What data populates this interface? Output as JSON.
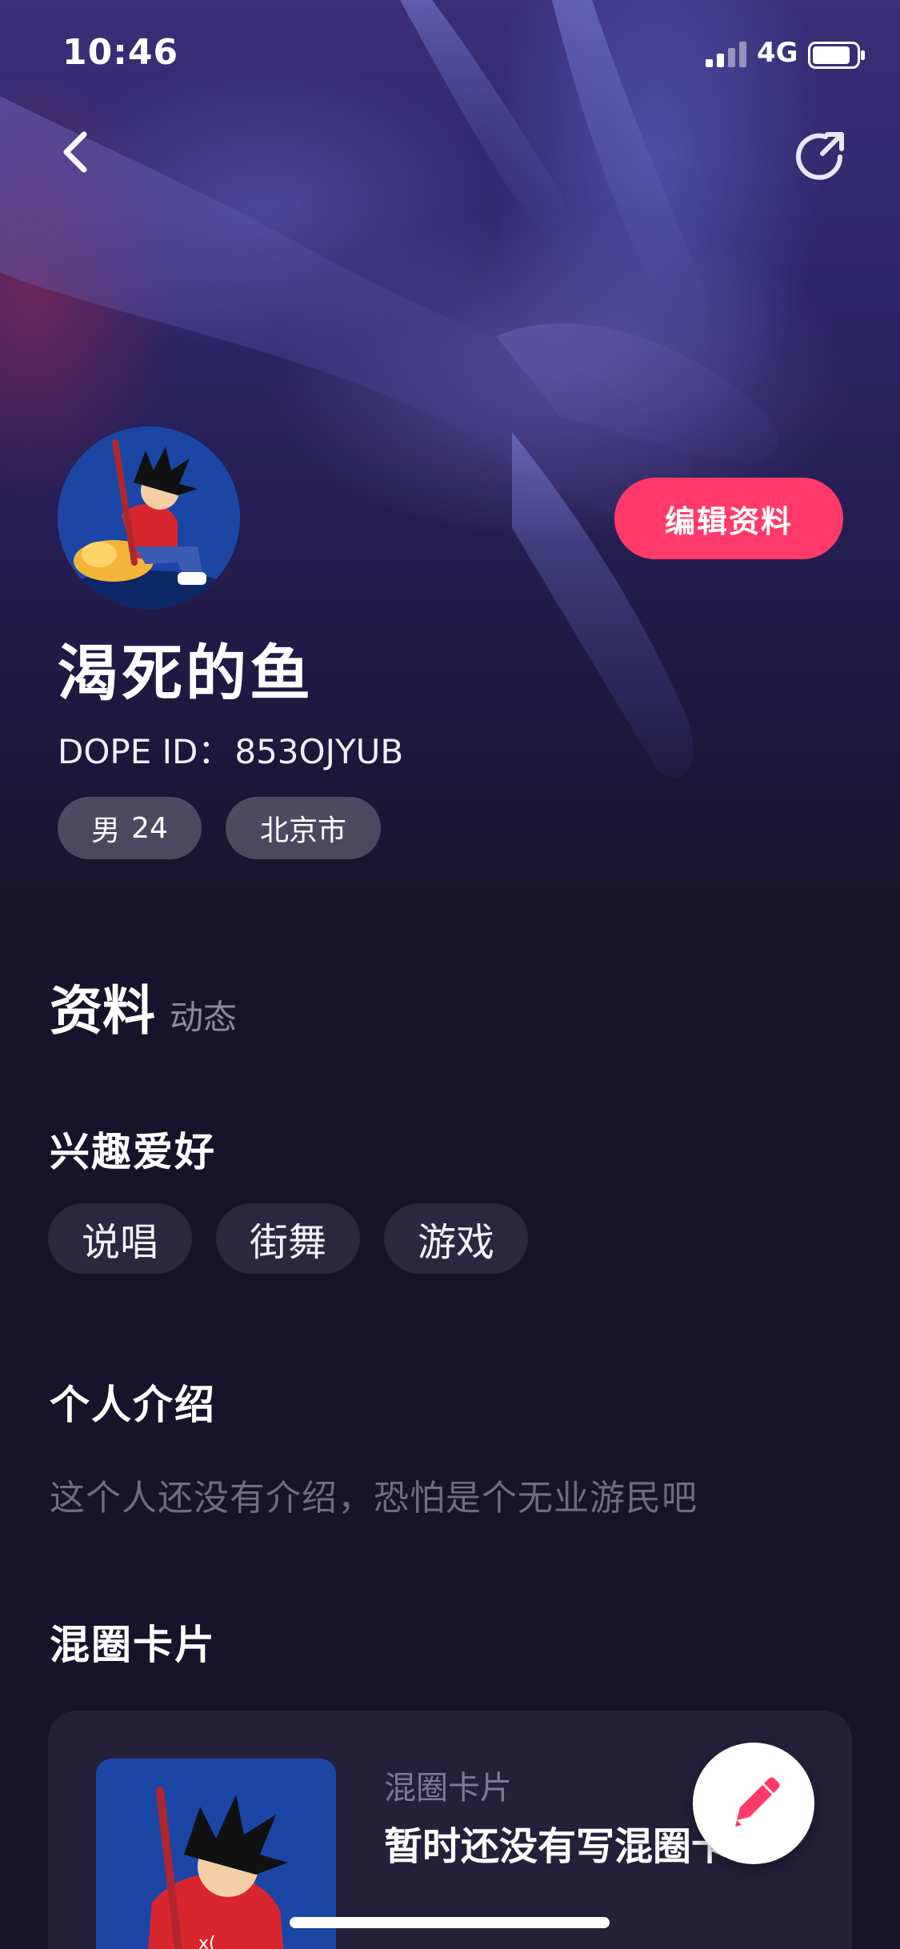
{
  "status_bar": {
    "time": "10:46",
    "network": "4G"
  },
  "profile": {
    "username": "渴死的鱼",
    "dope_id_label": "DOPE ID：",
    "dope_id_value": "853OJYUB",
    "gender": "男",
    "age": "24",
    "city": "北京市",
    "edit_button_label": "编辑资料"
  },
  "tabs": {
    "active": "资料",
    "inactive": "动态"
  },
  "interests": {
    "title": "兴趣爱好",
    "tags": [
      "说唱",
      "街舞",
      "游戏"
    ]
  },
  "intro": {
    "title": "个人介绍",
    "text": "这个人还没有介绍，恐怕是个无业游民吧"
  },
  "circle_card": {
    "section_title": "混圈卡片",
    "card_label": "混圈卡片",
    "card_text": "暂时还没有写混圈卡"
  },
  "icons": {
    "back": "chevron-left-icon",
    "share": "share-arrow-icon",
    "fab": "pencil-icon"
  },
  "colors": {
    "accent": "#ff3a69",
    "background": "#17132a",
    "card": "#25203a",
    "tag": "#2b2740",
    "muted_text": "#6f6b84"
  }
}
